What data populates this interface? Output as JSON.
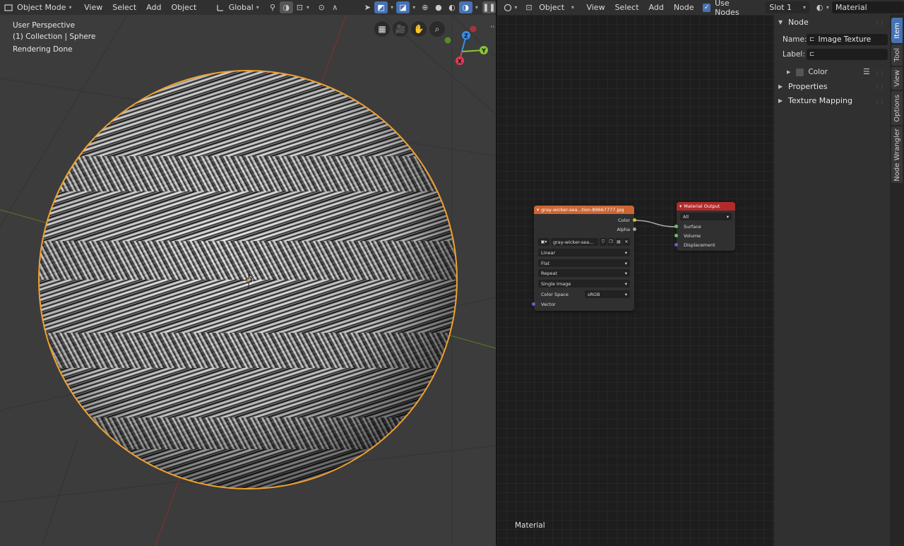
{
  "viewport_header": {
    "mode": "Object Mode",
    "menus": [
      "View",
      "Select",
      "Add",
      "Object"
    ],
    "orientation": "Global"
  },
  "viewport": {
    "perspective": "User Perspective",
    "collection": "(1) Collection | Sphere",
    "status": "Rendering Done",
    "gizmo": {
      "z": "Z",
      "y": "Y",
      "x": "X"
    }
  },
  "node_header": {
    "object": "Object",
    "menus": [
      "View",
      "Select",
      "Add",
      "Node"
    ],
    "use_nodes_label": "Use Nodes",
    "use_nodes_checked": true,
    "slot": "Slot 1",
    "material": "Material"
  },
  "image_node": {
    "title": "gray-wicker-sea...tion-89667777.jpg",
    "outputs": [
      "Color",
      "Alpha"
    ],
    "image_name": "gray-wicker-sea...",
    "interpolation": "Linear",
    "projection": "Flat",
    "extension": "Repeat",
    "source": "Single Image",
    "color_space_label": "Color Space",
    "color_space": "sRGB",
    "input": "Vector"
  },
  "output_node": {
    "title": "Material Output",
    "target": "All",
    "inputs": [
      "Surface",
      "Volume",
      "Displacement"
    ]
  },
  "node_footer": "Material",
  "sidebar": {
    "node_panel": "Node",
    "name_label": "Name:",
    "name_value": "Image Texture",
    "label_label": "Label:",
    "label_value": "",
    "color_label": "Color",
    "properties": "Properties",
    "texture_mapping": "Texture Mapping"
  },
  "tabs": [
    "Item",
    "Tool",
    "View",
    "Options",
    "Node Wrangler"
  ],
  "colors": {
    "accent": "#4772b3",
    "texture_node": "#cc6633",
    "output_node": "#b22b2b",
    "selection_outline": "#f0a030"
  }
}
